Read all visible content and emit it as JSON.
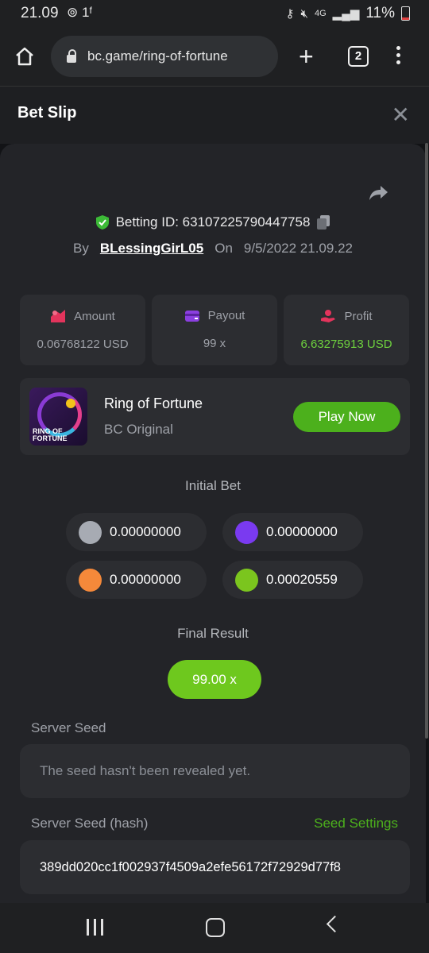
{
  "status": {
    "time": "21.09",
    "left_icons": "⊚ 1ᶠ",
    "network": "4G",
    "battery": "11%"
  },
  "browser": {
    "url": "bc.game/ring-of-fortune",
    "tab_count": "2"
  },
  "header": {
    "title": "Bet Slip"
  },
  "bet": {
    "betting_id": "Betting ID: 63107225790447758",
    "by_label": "By",
    "user": "BLessingGirL05",
    "on_label": "On",
    "date": "9/5/2022 21.09.22"
  },
  "stats": [
    {
      "label": "Amount",
      "value": "0.06768122 USD",
      "icon": "amount-icon",
      "color": "#e3345c"
    },
    {
      "label": "Payout",
      "value": "99 x",
      "icon": "wallet-icon",
      "color": "#8b3fe0"
    },
    {
      "label": "Profit",
      "value": "6.63275913 USD",
      "icon": "profit-hand-icon",
      "color": "#e3345c"
    }
  ],
  "game": {
    "name": "Ring of Fortune",
    "subtitle": "BC Original",
    "play_label": "Play Now",
    "thumb_text": "RING OF FORTUNE"
  },
  "initial_bet": {
    "title": "Initial Bet",
    "coins": [
      {
        "color": "#a7abb3",
        "amount": "0.00000000"
      },
      {
        "color": "#7a3af0",
        "amount": "0.00000000"
      },
      {
        "color": "#f5893a",
        "amount": "0.00000000"
      },
      {
        "color": "#7bc51e",
        "amount": "0.00020559"
      }
    ]
  },
  "final_result": {
    "title": "Final Result",
    "value": "99.00 x"
  },
  "server_seed": {
    "label": "Server Seed",
    "value": "The seed hasn't been revealed yet."
  },
  "server_seed_hash": {
    "label": "Server Seed (hash)",
    "settings_label": "Seed Settings",
    "value": "389dd020cc1f002937f4509a2efe56172f72929d77f8"
  }
}
